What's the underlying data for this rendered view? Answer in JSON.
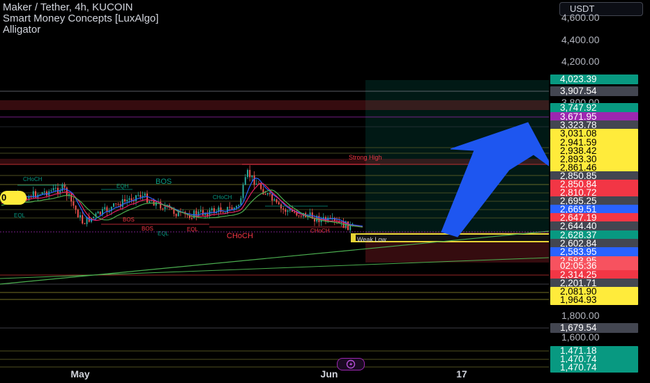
{
  "header": {
    "title": "Maker / Tether, 4h, KUCOIN",
    "indicator_1": "Smart Money Concepts [LuxAlgo]",
    "indicator_2": "Alligator"
  },
  "currency_button": "USDT",
  "chart_data": {
    "type": "line",
    "title": "Maker / Tether, 4h, KUCOIN",
    "y_axis_ticks": [
      "4,600.00",
      "4,400.00",
      "4,200.00",
      "3,800.00",
      "1,800.00",
      "1,600.00"
    ],
    "x_axis_ticks": [
      "May",
      "Jun",
      "17"
    ],
    "price_labels": [
      {
        "text": "4,023.39",
        "value": 4023.39,
        "bg": "#089981",
        "fg": "#ffffff"
      },
      {
        "text": "3,907.54",
        "value": 3907.54,
        "bg": "#434651",
        "fg": "#ffffff"
      },
      {
        "text": "3,747.92",
        "value": 3747.92,
        "bg": "#089981",
        "fg": "#ffffff"
      },
      {
        "text": "3,671.95",
        "value": 3671.95,
        "bg": "#9c27b0",
        "fg": "#ffffff"
      },
      {
        "text": "3,323.78",
        "value": 3323.78,
        "bg": "#434651",
        "fg": "#ffffff"
      },
      {
        "text": "3,031.08",
        "value": 3031.08,
        "bg": "#ffeb3b",
        "fg": "#000000"
      },
      {
        "text": "2,941.59",
        "value": 2941.59,
        "bg": "#ffeb3b",
        "fg": "#000000"
      },
      {
        "text": "2,938.42",
        "value": 2938.42,
        "bg": "#ffeb3b",
        "fg": "#000000"
      },
      {
        "text": "2,893.30",
        "value": 2893.3,
        "bg": "#ffeb3b",
        "fg": "#000000"
      },
      {
        "text": "2,861.46",
        "value": 2861.46,
        "bg": "#ffeb3b",
        "fg": "#000000"
      },
      {
        "text": "2,850.85",
        "value": 2850.85,
        "bg": "#434651",
        "fg": "#ffffff"
      },
      {
        "text": "2,850.84",
        "value": 2850.84,
        "bg": "#f23645",
        "fg": "#ffffff"
      },
      {
        "text": "2,810.72",
        "value": 2810.72,
        "bg": "#f23645",
        "fg": "#ffffff"
      },
      {
        "text": "2,695.25",
        "value": 2695.25,
        "bg": "#434651",
        "fg": "#ffffff"
      },
      {
        "text": "2,669.51",
        "value": 2669.51,
        "bg": "#2962ff",
        "fg": "#ffffff"
      },
      {
        "text": "2,647.19",
        "value": 2647.19,
        "bg": "#f23645",
        "fg": "#ffffff"
      },
      {
        "text": "2,644.40",
        "value": 2644.4,
        "bg": "#434651",
        "fg": "#ffffff"
      },
      {
        "text": "2,628.37",
        "value": 2628.37,
        "bg": "#089981",
        "fg": "#ffffff"
      },
      {
        "text": "2,602.84",
        "value": 2602.84,
        "bg": "#434651",
        "fg": "#ffffff"
      },
      {
        "text": "2,583.95",
        "value": 2583.95,
        "bg": "#2962ff",
        "fg": "#ffffff"
      },
      {
        "text": "2,583.95",
        "value": 2583.94,
        "bg": "#f7525f",
        "fg": "#ffffff"
      },
      {
        "text": "02:05:36",
        "value": 2555.0,
        "bg": "#f7525f",
        "fg": "#ffffff"
      },
      {
        "text": "2,314.25",
        "value": 2314.25,
        "bg": "#f23645",
        "fg": "#ffffff"
      },
      {
        "text": "2,201.71",
        "value": 2201.71,
        "bg": "#434651",
        "fg": "#ffffff"
      },
      {
        "text": "2,081.90",
        "value": 2081.9,
        "bg": "#ffeb3b",
        "fg": "#000000"
      },
      {
        "text": "1,964.93",
        "value": 1964.93,
        "bg": "#ffeb3b",
        "fg": "#000000"
      },
      {
        "text": "1,679.54",
        "value": 1679.54,
        "bg": "#434651",
        "fg": "#ffffff"
      },
      {
        "text": "1,471.18",
        "value": 1471.18,
        "bg": "#089981",
        "fg": "#ffffff"
      },
      {
        "text": "1,470.74",
        "value": 1470.74,
        "bg": "#089981",
        "fg": "#ffffff"
      },
      {
        "text": "1,470.74",
        "value": 1470.73,
        "bg": "#089981",
        "fg": "#ffffff"
      }
    ],
    "annotations": [
      "Strong High",
      "Weak Low",
      "BOS",
      "BOS",
      "BOS",
      "CHoCH",
      "CHoCH",
      "CHoCH",
      "CHoCH",
      "EQH",
      "EQL",
      "EQL",
      "EQL"
    ],
    "price_badge": "0"
  }
}
